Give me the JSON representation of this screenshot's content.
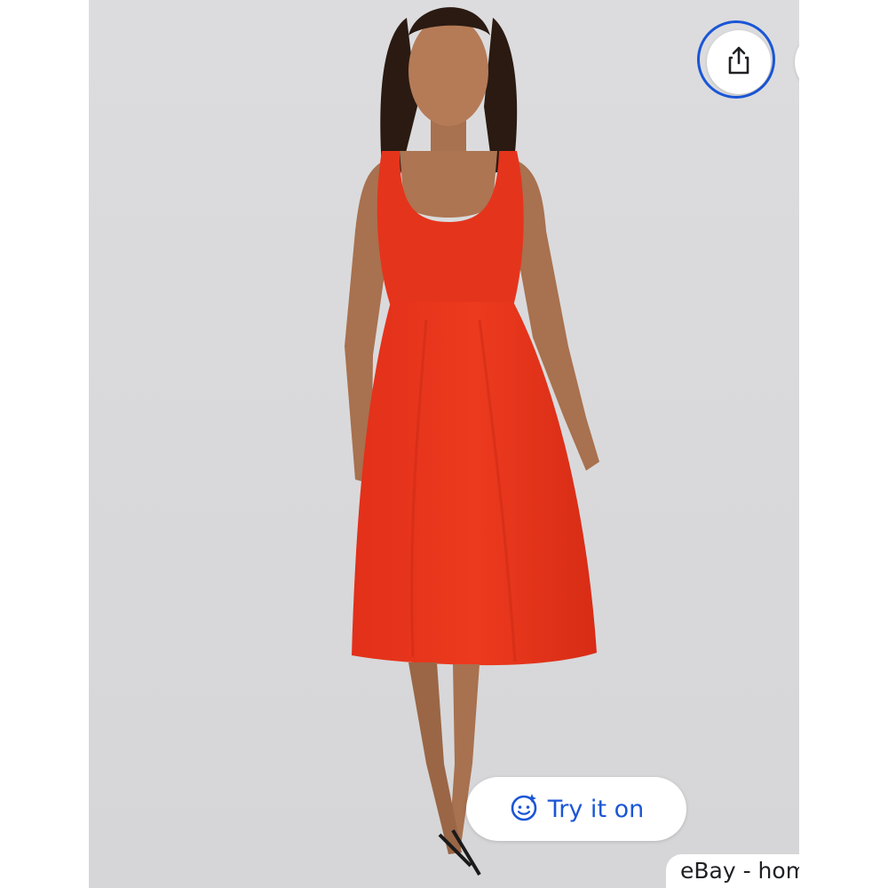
{
  "actions": {
    "share_icon": "share-icon",
    "more_icon": "more-vert-icon",
    "try_on": {
      "label": "Try it on",
      "icon": "sparkle-face-icon"
    }
  },
  "source": {
    "label": "eBay - hometown_s"
  },
  "colors": {
    "accent": "#1a56d6",
    "background": "#d9d9db",
    "dress": "#e8321a"
  }
}
